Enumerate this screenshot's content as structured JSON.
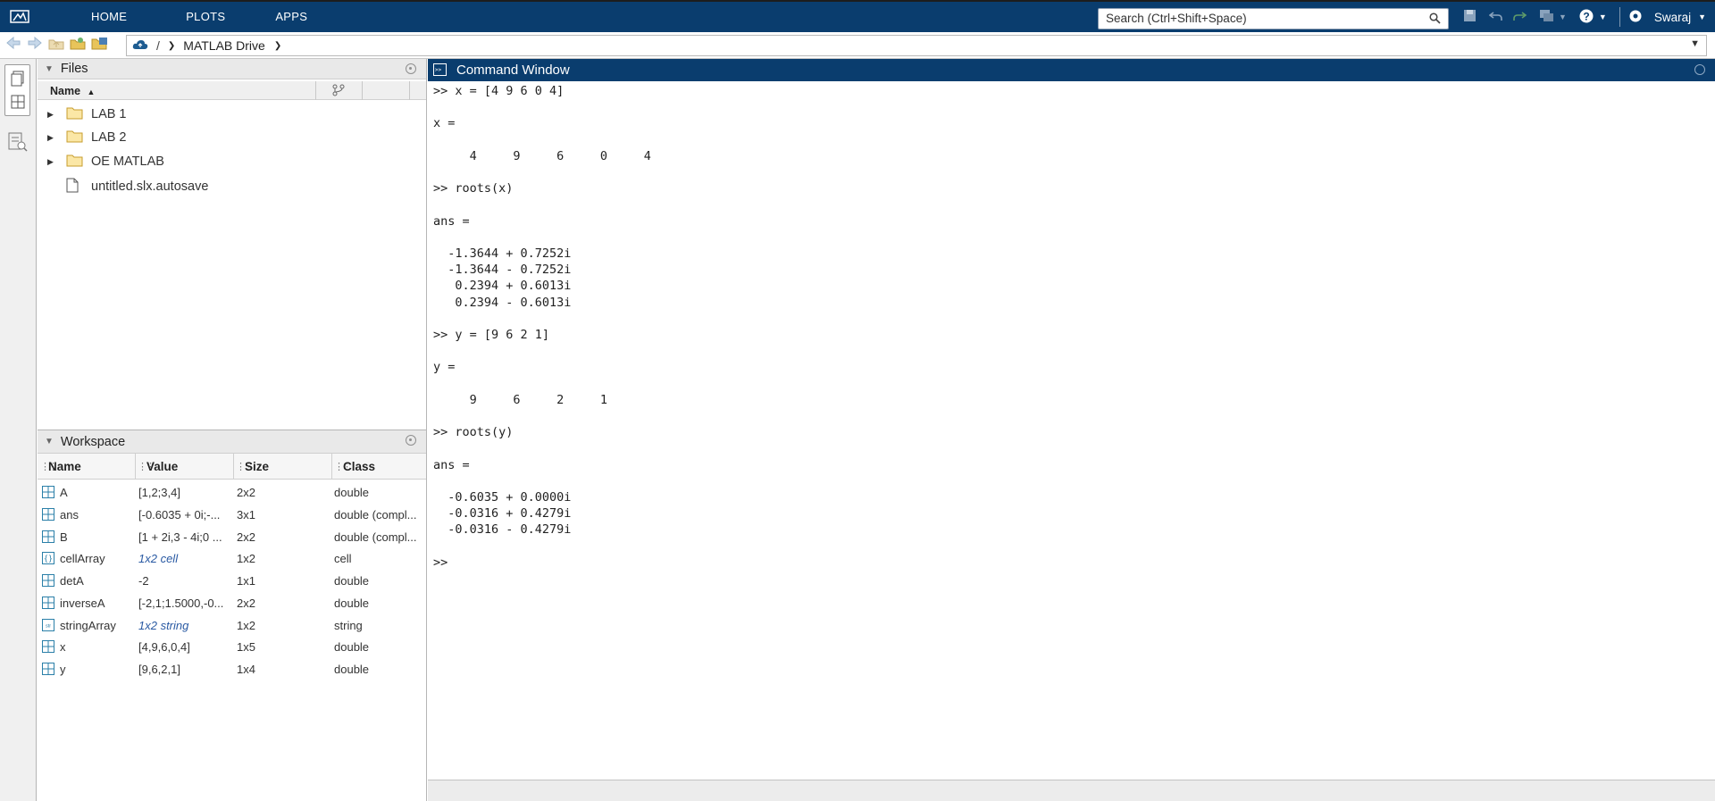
{
  "ribbon": {
    "tabs": [
      "HOME",
      "PLOTS",
      "APPS"
    ],
    "search_placeholder": "Search (Ctrl+Shift+Space)",
    "user": "Swaraj"
  },
  "address": {
    "root": "/",
    "folder": "MATLAB Drive"
  },
  "files": {
    "title": "Files",
    "col_name": "Name",
    "items": [
      {
        "name": "LAB 1",
        "type": "folder"
      },
      {
        "name": "LAB 2",
        "type": "folder"
      },
      {
        "name": "OE MATLAB",
        "type": "folder"
      },
      {
        "name": "untitled.slx.autosave",
        "type": "file"
      }
    ]
  },
  "workspace": {
    "title": "Workspace",
    "columns": [
      "Name",
      "Value",
      "Size",
      "Class"
    ],
    "rows": [
      {
        "name": "A",
        "value": "[1,2;3,4]",
        "size": "2x2",
        "class": "double",
        "icon": "matrix-icon"
      },
      {
        "name": "ans",
        "value": "[-0.6035 + 0i;-...",
        "size": "3x1",
        "class": "double (compl...",
        "icon": "matrix-icon"
      },
      {
        "name": "B",
        "value": "[1 + 2i,3 - 4i;0 ...",
        "size": "2x2",
        "class": "double (compl...",
        "icon": "matrix-icon"
      },
      {
        "name": "cellArray",
        "value": "1x2 cell",
        "size": "1x2",
        "class": "cell",
        "icon": "cell-icon",
        "italic": true
      },
      {
        "name": "detA",
        "value": "-2",
        "size": "1x1",
        "class": "double",
        "icon": "matrix-icon"
      },
      {
        "name": "inverseA",
        "value": "[-2,1;1.5000,-0...",
        "size": "2x2",
        "class": "double",
        "icon": "matrix-icon"
      },
      {
        "name": "stringArray",
        "value": "1x2 string",
        "size": "1x2",
        "class": "string",
        "icon": "string-icon",
        "italic": true
      },
      {
        "name": "x",
        "value": "[4,9,6,0,4]",
        "size": "1x5",
        "class": "double",
        "icon": "matrix-icon"
      },
      {
        "name": "y",
        "value": "[9,6,2,1]",
        "size": "1x4",
        "class": "double",
        "icon": "matrix-icon"
      }
    ]
  },
  "command_window": {
    "title": "Command Window",
    "output": ">> x = [4 9 6 0 4]\n\nx =\n\n     4     9     6     0     4\n\n>> roots(x)\n\nans =\n\n  -1.3644 + 0.7252i\n  -1.3644 - 0.7252i\n   0.2394 + 0.6013i\n   0.2394 - 0.6013i\n\n>> y = [9 6 2 1]\n\ny =\n\n     9     6     2     1\n\n>> roots(y)\n\nans =\n\n  -0.6035 + 0.0000i\n  -0.0316 + 0.4279i\n  -0.0316 - 0.4279i\n\n>> "
  },
  "colors": {
    "ribbon_bg": "#0a3d6e",
    "panel_header_bg": "#e9e9e9",
    "folder": "#e8c45a",
    "matrix_icon": "#2a7fa8"
  }
}
